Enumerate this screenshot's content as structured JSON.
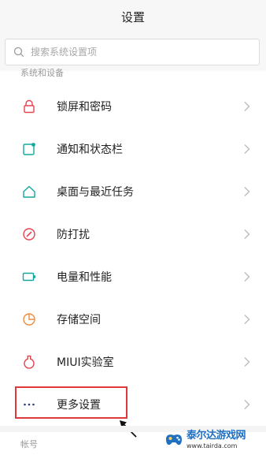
{
  "header": {
    "title": "设置"
  },
  "search": {
    "placeholder": "搜索系统设置项"
  },
  "section_top": {
    "label": "系统和设备"
  },
  "items": [
    {
      "label": "锁屏和密码",
      "icon": "lock-icon"
    },
    {
      "label": "通知和状态栏",
      "icon": "notification-icon"
    },
    {
      "label": "桌面与最近任务",
      "icon": "home-icon"
    },
    {
      "label": "防打扰",
      "icon": "do-not-disturb-icon"
    },
    {
      "label": "电量和性能",
      "icon": "battery-icon"
    },
    {
      "label": "存储空间",
      "icon": "storage-icon"
    },
    {
      "label": "MIUI实验室",
      "icon": "lab-flask-icon"
    },
    {
      "label": "更多设置",
      "icon": "more-dots-icon"
    }
  ],
  "section_bottom": {
    "label": "帐号"
  },
  "watermark": {
    "name": "泰尔达游戏网",
    "url": "www.tairda.com"
  },
  "colors": {
    "accent_red": "#e0393b",
    "icon_teal": "#13a89e",
    "icon_pink": "#e8424f",
    "icon_orange": "#f08a3c",
    "brand_blue": "#1f6fc2"
  }
}
